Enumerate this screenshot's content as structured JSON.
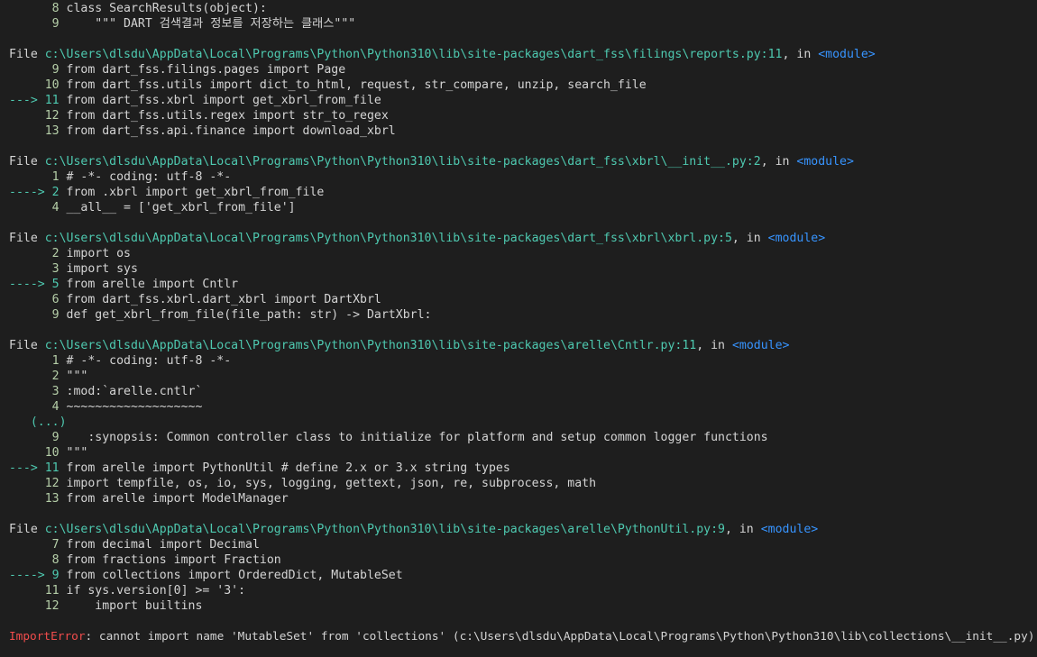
{
  "frames": [
    {
      "file_label": "File",
      "path": "c:\\Users\\dlsdu\\AppData\\Local\\Programs\\Python\\Python310\\lib\\site-packages\\dart_fss\\filings\\reports.py:11",
      "in_text": ", in",
      "module": "<module>",
      "lines": [
        {
          "marker": "      9",
          "code": "from dart_fss.filings.pages import Page"
        },
        {
          "marker": "     10",
          "code": "from dart_fss.utils import dict_to_html, request, str_compare, unzip, search_file"
        },
        {
          "marker": "---> 11",
          "code": "from dart_fss.xbrl import get_xbrl_from_file"
        },
        {
          "marker": "     12",
          "code": "from dart_fss.utils.regex import str_to_regex"
        },
        {
          "marker": "     13",
          "code": "from dart_fss.api.finance import download_xbrl"
        }
      ]
    },
    {
      "file_label": "File",
      "path": "c:\\Users\\dlsdu\\AppData\\Local\\Programs\\Python\\Python310\\lib\\site-packages\\dart_fss\\xbrl\\__init__.py:2",
      "in_text": ", in",
      "module": "<module>",
      "lines": [
        {
          "marker": "      1",
          "code": "# -*- coding: utf-8 -*-"
        },
        {
          "marker": "----> 2",
          "code": "from .xbrl import get_xbrl_from_file"
        },
        {
          "marker": "      4",
          "code": "__all__ = ['get_xbrl_from_file']"
        }
      ]
    },
    {
      "file_label": "File",
      "path": "c:\\Users\\dlsdu\\AppData\\Local\\Programs\\Python\\Python310\\lib\\site-packages\\dart_fss\\xbrl\\xbrl.py:5",
      "in_text": ", in",
      "module": "<module>",
      "lines": [
        {
          "marker": "      2",
          "code": "import os"
        },
        {
          "marker": "      3",
          "code": "import sys"
        },
        {
          "marker": "----> 5",
          "code": "from arelle import Cntlr"
        },
        {
          "marker": "      6",
          "code": "from dart_fss.xbrl.dart_xbrl import DartXbrl"
        },
        {
          "marker": "      9",
          "code": "def get_xbrl_from_file(file_path: str) -> DartXbrl:"
        }
      ]
    },
    {
      "file_label": "File",
      "path": "c:\\Users\\dlsdu\\AppData\\Local\\Programs\\Python\\Python310\\lib\\site-packages\\arelle\\Cntlr.py:11",
      "in_text": ", in",
      "module": "<module>",
      "lines": [
        {
          "marker": "      1",
          "code": "# -*- coding: utf-8 -*-"
        },
        {
          "marker": "      2",
          "code": "\"\"\""
        },
        {
          "marker": "      3",
          "code": ":mod:`arelle.cntlr`"
        },
        {
          "marker": "      4",
          "code": "~~~~~~~~~~~~~~~~~~~"
        },
        {
          "marker": "   (...)",
          "code": ""
        },
        {
          "marker": "      9",
          "code": "   :synopsis: Common controller class to initialize for platform and setup common logger functions"
        },
        {
          "marker": "     10",
          "code": "\"\"\""
        },
        {
          "marker": "---> 11",
          "code": "from arelle import PythonUtil # define 2.x or 3.x string types"
        },
        {
          "marker": "     12",
          "code": "import tempfile, os, io, sys, logging, gettext, json, re, subprocess, math"
        },
        {
          "marker": "     13",
          "code": "from arelle import ModelManager"
        }
      ]
    },
    {
      "file_label": "File",
      "path": "c:\\Users\\dlsdu\\AppData\\Local\\Programs\\Python\\Python310\\lib\\site-packages\\arelle\\PythonUtil.py:9",
      "in_text": ", in",
      "module": "<module>",
      "lines": [
        {
          "marker": "      7",
          "code": "from decimal import Decimal"
        },
        {
          "marker": "      8",
          "code": "from fractions import Fraction"
        },
        {
          "marker": "----> 9",
          "code": "from collections import OrderedDict, MutableSet"
        },
        {
          "marker": "     11",
          "code": "if sys.version[0] >= '3':"
        },
        {
          "marker": "     12",
          "code": "    import builtins"
        }
      ]
    }
  ],
  "top_lines": [
    {
      "marker": "      8",
      "code": "class SearchResults(object):"
    },
    {
      "marker": "      9",
      "code": "    \"\"\" DART 검색결과 정보를 저장하는 클래스\"\"\""
    }
  ],
  "error": {
    "type": "ImportError",
    "message": ": cannot import name 'MutableSet' from 'collections' (c:\\Users\\dlsdu\\AppData\\Local\\Programs\\Python\\Python310\\lib\\collections\\__init__.py)"
  },
  "colors": {
    "background": "#1e1e1e",
    "text": "#d4d4d4",
    "path": "#4ec9b0",
    "module": "#3794ff",
    "error": "#f14c4c"
  }
}
